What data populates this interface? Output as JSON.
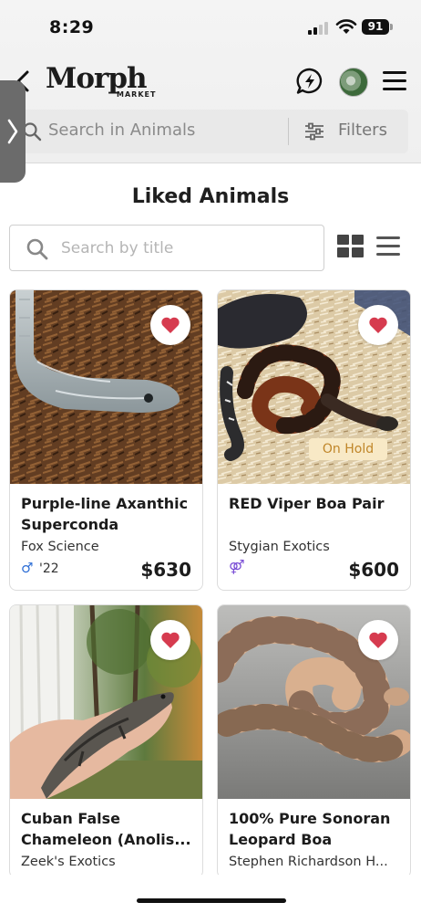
{
  "status_bar": {
    "time": "8:29",
    "battery": "91"
  },
  "header": {
    "logo_text": "Morph",
    "logo_sub": "MARKET"
  },
  "search": {
    "placeholder": "Search in Animals",
    "filters_label": "Filters"
  },
  "page": {
    "title": "Liked Animals",
    "title_search_placeholder": "Search by title"
  },
  "cards": [
    {
      "title": "Purple-line Axanthic Superconda",
      "seller": "Fox Science",
      "gender": "♂",
      "year": "'22",
      "price": "$630",
      "badge": ""
    },
    {
      "title": "RED Viper Boa Pair",
      "seller": "Stygian Exotics",
      "gender": "⚤",
      "year": "",
      "price": "$600",
      "badge": "On Hold"
    },
    {
      "title": "Cuban False Chameleon (Anolis...",
      "seller": "Zeek's Exotics",
      "gender": "",
      "year": "",
      "price": "",
      "badge": ""
    },
    {
      "title": "100% Pure Sonoran Leopard Boa",
      "seller": "Stephen Richardson H...",
      "gender": "",
      "year": "",
      "price": "",
      "badge": ""
    }
  ],
  "colors": {
    "heart": "#d63b4f",
    "male": "#2f6fd6",
    "pair": "#7b4fd6",
    "on_hold_bg": "#f8e9c6",
    "on_hold_text": "#c0862a"
  }
}
